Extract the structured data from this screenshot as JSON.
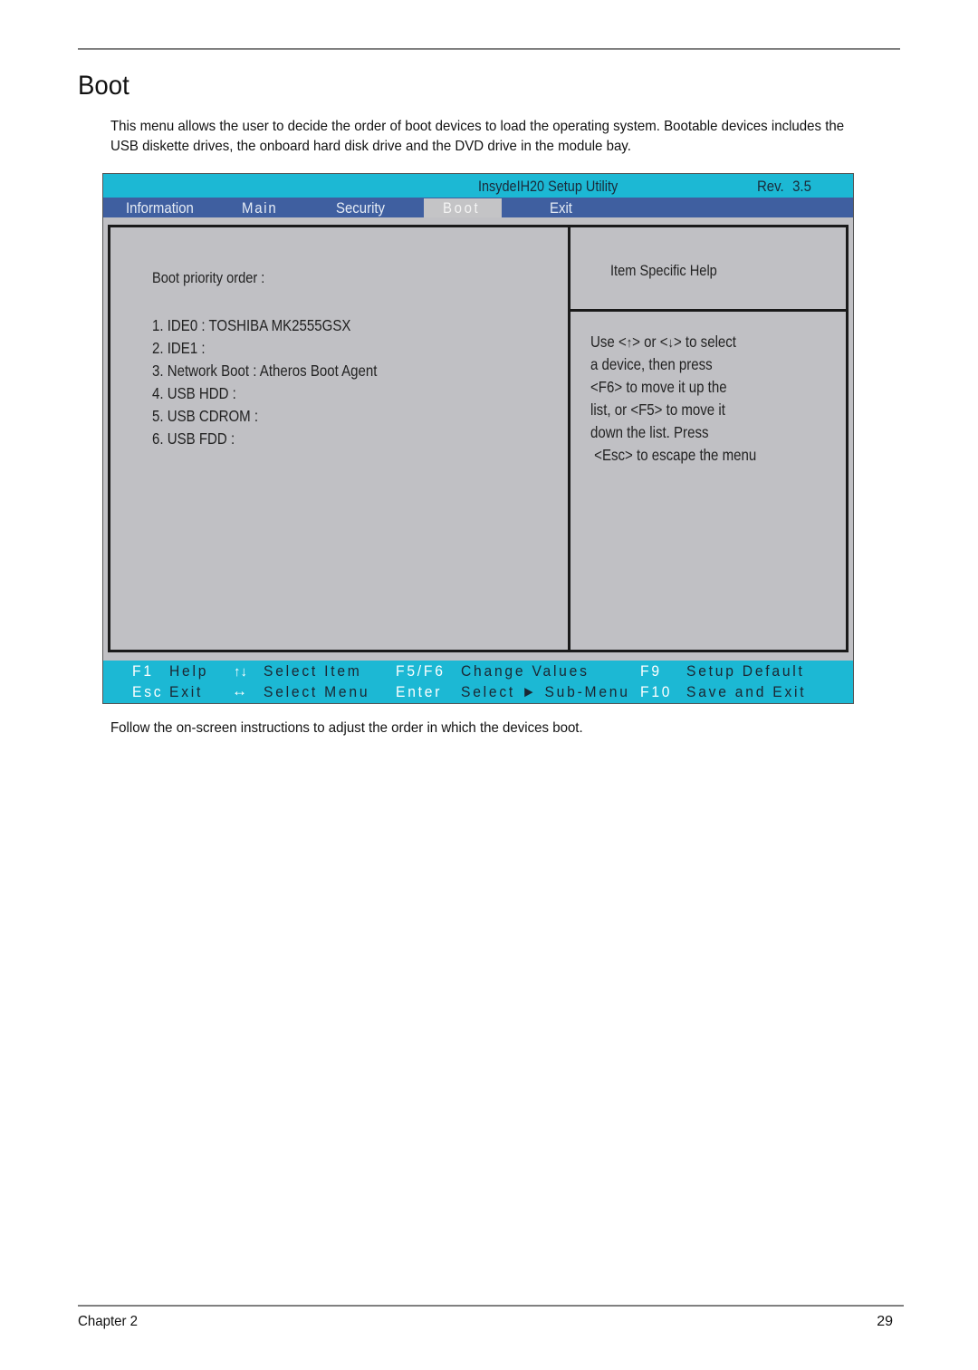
{
  "page": {
    "title": "Boot",
    "intro": "This menu allows the user to decide the order of boot devices to load the operating system. Bootable devices includes the USB diskette drives, the onboard hard disk drive and the DVD drive in the module bay.",
    "follow_text": "Follow the on-screen instructions to adjust the order in which the devices boot.",
    "footer": {
      "chapter": "Chapter 2",
      "page_number": "29"
    }
  },
  "bios": {
    "title": "InsydeIH20 Setup Utility",
    "revision": "Rev. 3.5",
    "colors": {
      "title_bar": "#1cb8d4",
      "menu_bar": "#3f5fa0",
      "body": "#c0c0c4",
      "active_tab": "#c4c4c6"
    },
    "menu": [
      {
        "label": "Information",
        "active": false
      },
      {
        "label": "Main",
        "active": false
      },
      {
        "label": "Security",
        "active": false
      },
      {
        "label": "Boot",
        "active": true
      },
      {
        "label": "Exit",
        "active": false
      }
    ],
    "boot_heading": "Boot priority order :",
    "boot_order": [
      "1. IDE0  :  TOSHIBA MK2555GSX",
      "2. IDE1  :",
      "3. Network Boot  :  Atheros Boot Agent",
      "4. USB HDD  :",
      "5. USB CDROM  :",
      "6. USB FDD  :"
    ],
    "help": {
      "heading": "Item Specific Help",
      "line1_pre": "Use <",
      "line1_up": "↑",
      "line1_mid": "> or <",
      "line1_down": "↓",
      "line1_post": "> to select",
      "lines": [
        "a device, then press",
        "<F6> to move it up the",
        "list, or <F5> to move it",
        "down the list. Press",
        " <Esc> to escape the menu"
      ]
    },
    "footer_keys": {
      "f1_key": "F1",
      "f1_desc": "Help",
      "esc_key": "Esc",
      "esc_desc": "Exit",
      "updown_icon": "↑↓",
      "updown_desc": "Select  Item",
      "leftright_icon": "↔",
      "leftright_desc": "Select  Menu",
      "f5f6_key": "F5/F6",
      "f5f6_desc": "Change  Values",
      "enter_key": "Enter",
      "enter_desc": "Select ► Sub-Menu",
      "f9_key": "F9",
      "f9_desc": "Setup  Default",
      "f10_key": "F10",
      "f10_desc": "Save  and  Exit"
    }
  }
}
